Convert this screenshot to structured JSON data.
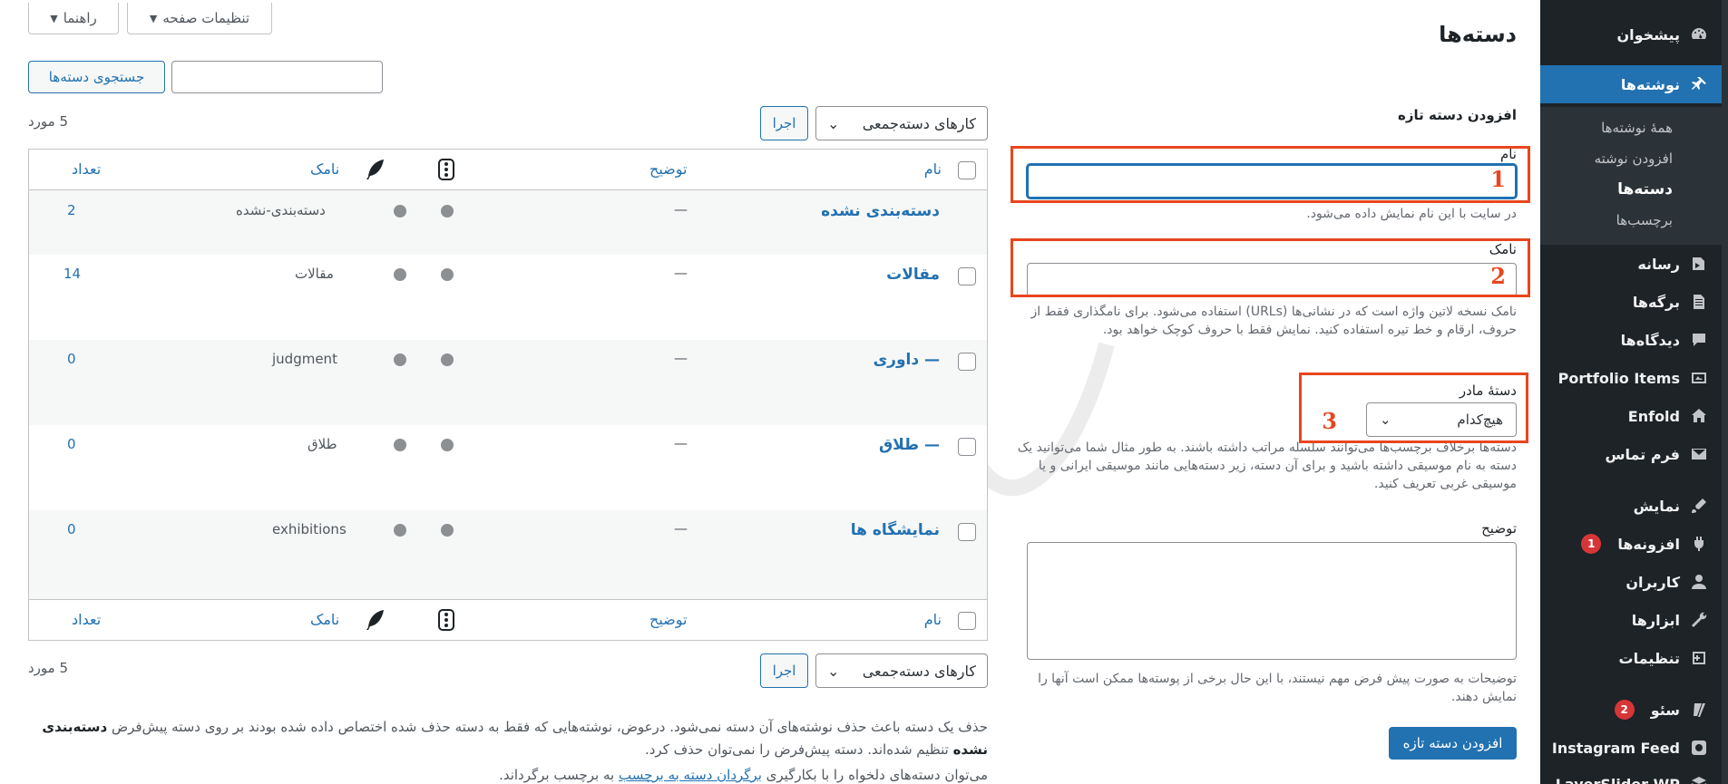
{
  "sidebar": {
    "items": [
      {
        "label": "پیشخوان",
        "icon": "dashboard-icon"
      },
      {
        "label": "نوشته‌ها",
        "icon": "pin-icon",
        "current": true
      },
      {
        "label": "رسانه",
        "icon": "media-icon"
      },
      {
        "label": "برگه‌ها",
        "icon": "pages-icon"
      },
      {
        "label": "دیدگاه‌ها",
        "icon": "comments-icon"
      },
      {
        "label": "Portfolio Items",
        "icon": "portfolio-icon"
      },
      {
        "label": "Enfold",
        "icon": "home-icon"
      },
      {
        "label": "فرم تماس",
        "icon": "mail-icon"
      },
      {
        "label": "نمایش",
        "icon": "appearance-icon"
      },
      {
        "label": "افزونه‌ها",
        "icon": "plugins-icon",
        "badge": "1"
      },
      {
        "label": "کاربران",
        "icon": "users-icon"
      },
      {
        "label": "ابزارها",
        "icon": "tools-icon"
      },
      {
        "label": "تنظیمات",
        "icon": "settings-icon"
      },
      {
        "label": "سئو",
        "icon": "yoast-icon",
        "badge": "2"
      },
      {
        "label": "Instagram Feed",
        "icon": "instagram-icon"
      },
      {
        "label": "LayerSlider WP",
        "icon": "layerslider-icon"
      }
    ],
    "submenu": [
      {
        "label": "همهٔ نوشته‌ها"
      },
      {
        "label": "افزودن نوشته"
      },
      {
        "label": "دسته‌ها",
        "current": true
      },
      {
        "label": "برچسب‌ها"
      }
    ]
  },
  "top": {
    "screen_options": "تنظیمات صفحه",
    "help": "راهنما"
  },
  "page_title": "دسته‌ها",
  "form": {
    "heading": "افزودن دسته تازه",
    "name_label": "نام",
    "name_help": "در سایت با این نام نمایش داده می‌شود.",
    "slug_label": "نامک",
    "slug_help": "نامک نسخه لاتین واژه است که در نشانی‌ها (URLs) استفاده می‌شود. برای نامگذاری فقط از حروف، ارقام و خط تیره استفاده کنید. نمایش فقط با حروف کوچک خواهد بود.",
    "parent_label": "دستهٔ مادر",
    "parent_value": "هیچ‌کدام",
    "parent_help": "دسته‌ها برخلاف برچسب‌ها می‌توانند سلسله مراتب داشته باشند. به طور مثال شما می‌توانید یک دسته به نام موسیقی داشته باشید و برای آن دسته، زیر دسته‌هایی مانند موسیقی ایرانی و یا موسیقی غربی تعریف کنید.",
    "desc_label": "توضیح",
    "desc_help": "توضیحات به صورت پیش فرض مهم نیستند، با این حال برخی از پوسته‌ها ممکن است آنها را نمایش دهند.",
    "submit": "افزودن دسته تازه"
  },
  "annotations": [
    "1",
    "2",
    "3"
  ],
  "list": {
    "search_button": "جستجوی دسته‌ها",
    "bulk_label": "کارهای دسته‌جمعی",
    "apply": "اجرا",
    "count": "5 مورد",
    "columns": {
      "name": "نام",
      "desc": "توضیح",
      "slug": "نامک",
      "count": "تعداد"
    },
    "rows": [
      {
        "name": "دسته‌بندی نشده",
        "desc": "—",
        "slug": "دسته‌بندی-نشده",
        "count": "2"
      },
      {
        "name": "مقالات",
        "desc": "—",
        "slug": "مقالات",
        "count": "14"
      },
      {
        "name": "— داوری",
        "desc": "—",
        "slug": "judgment",
        "count": "0"
      },
      {
        "name": "— طلاق",
        "desc": "—",
        "slug": "طلاق",
        "count": "0"
      },
      {
        "name": "نمایشگاه ها",
        "desc": "—",
        "slug": "exhibitions",
        "count": "0"
      }
    ]
  },
  "footer": {
    "note1": "حذف یک دسته باعث حذف نوشته‌های آن دسته نمی‌شود. درعوض، نوشته‌هایی که فقط به دسته حذف شده اختصاص داده شده بودند بر روی دسته پیش‌فرض",
    "note1_bold": "دسته‌بندی نشده",
    "note1_tail": "تنظیم شده‌اند. دسته پیش‌فرض را نمی‌توان حذف کرد.",
    "note2_pre": "می‌توان دسته‌های دلخواه را با بکارگیری",
    "note2_link": "برگردان دسته به برچسب",
    "note2_post": "به برچسب برگرداند."
  }
}
